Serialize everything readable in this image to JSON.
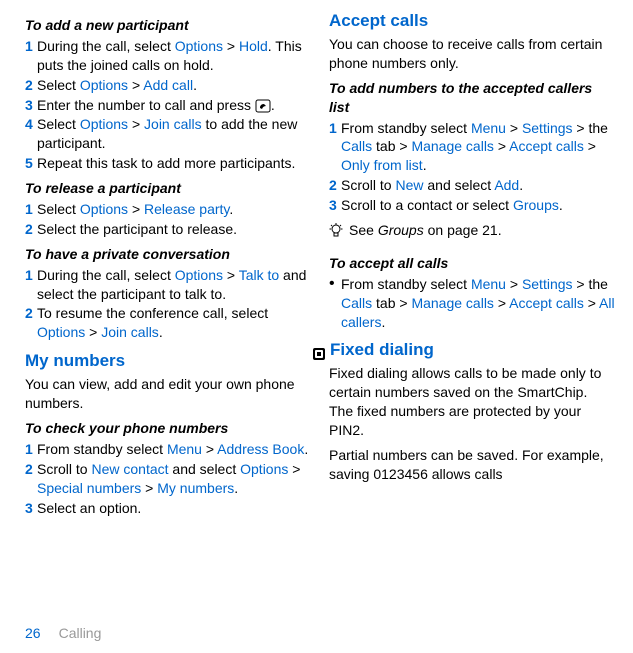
{
  "col1": {
    "h1": "To add a new participant",
    "s1": [
      {
        "n": "1",
        "pre": "During the call, select ",
        "l1": "Options",
        "m1": " > ",
        "l2": "Hold",
        "post": ". This puts the joined calls on hold."
      },
      {
        "n": "2",
        "pre": "Select ",
        "l1": "Options",
        "m1": " > ",
        "l2": "Add call",
        "post": "."
      },
      {
        "n": "3",
        "pre": "Enter the number to call and press ",
        "post": "."
      },
      {
        "n": "4",
        "pre": "Select ",
        "l1": "Options",
        "m1": " > ",
        "l2": "Join calls",
        "post": " to add the new participant."
      },
      {
        "n": "5",
        "pre": "Repeat this task to add more participants.",
        "post": ""
      }
    ],
    "h2": "To release a participant",
    "s2": [
      {
        "n": "1",
        "pre": "Select ",
        "l1": "Options",
        "m1": " > ",
        "l2": "Release party",
        "post": "."
      },
      {
        "n": "2",
        "pre": "Select the participant to release.",
        "post": ""
      }
    ],
    "h3": "To have a private conversation",
    "s3": [
      {
        "n": "1",
        "pre": "During the call, select ",
        "l1": "Options",
        "m1": " > ",
        "l2": "Talk to",
        "post": " and select the participant to talk to."
      },
      {
        "n": "2",
        "pre": "To resume the conference call, select ",
        "l1": "Options",
        "m1": " > ",
        "l2": "Join calls",
        "post": "."
      }
    ],
    "sec1": "My numbers",
    "sec1body": "You can view, add and edit your own phone numbers.",
    "h4": "To check your phone numbers",
    "s4": [
      {
        "n": "1",
        "pre": "From standby select ",
        "l1": "Menu",
        "m1": " > ",
        "l2": "Address Book",
        "post": "."
      },
      {
        "n": "2",
        "pre": "Scroll to ",
        "l1": "New contact",
        "m1": " and select ",
        "l2": "Options",
        "m2": " > ",
        "l3": "Special numbers",
        "m3": " > ",
        "l4": "My numbers",
        "post": "."
      },
      {
        "n": "3",
        "pre": "Select an option.",
        "post": ""
      }
    ]
  },
  "col2": {
    "sec1": "Accept calls",
    "sec1body": "You can choose to receive calls from certain phone numbers only.",
    "h1": "To add numbers to the accepted callers list",
    "s1": [
      {
        "n": "1",
        "pre": "From standby select ",
        "l1": "Menu",
        "m1": " > ",
        "l2": "Settings",
        "m2": " > the ",
        "l3": "Calls",
        "m3": " tab > ",
        "l4": "Manage calls",
        "m4": " > ",
        "l5": "Accept calls",
        "m5": " > ",
        "l6": "Only from list",
        "post": "."
      },
      {
        "n": "2",
        "pre": "Scroll to ",
        "l1": "New",
        "m1": " and select ",
        "l2": "Add",
        "post": "."
      },
      {
        "n": "3",
        "pre": "Scroll to a contact or select ",
        "l1": "Groups",
        "post": "."
      }
    ],
    "tip_pre": "See ",
    "tip_em": "Groups",
    "tip_post": " on page 21.",
    "h2": "To accept all calls",
    "s2": [
      {
        "bullet": "•",
        "pre": "From standby select ",
        "l1": "Menu",
        "m1": " > ",
        "l2": "Settings",
        "m2": " > the ",
        "l3": "Calls",
        "m3": " tab > ",
        "l4": "Manage calls",
        "m4": " > ",
        "l5": "Accept calls",
        "m5": " > ",
        "l6": "All callers",
        "post": "."
      }
    ],
    "sec2": "Fixed dialing",
    "sec2body1": "Fixed dialing allows calls to be made only to certain numbers saved on the SmartChip. The fixed numbers are protected by your PIN2.",
    "sec2body2": "Partial numbers can be saved. For example, saving 0123456 allows calls"
  },
  "footer": {
    "page": "26",
    "section": "Calling"
  }
}
